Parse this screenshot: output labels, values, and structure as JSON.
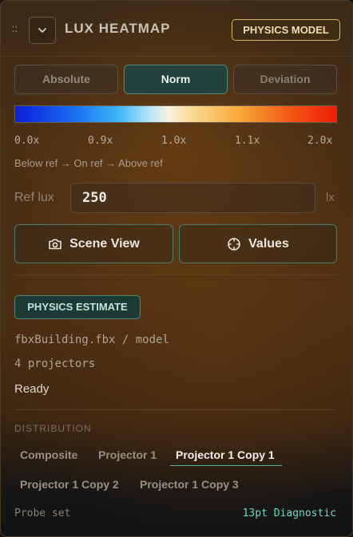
{
  "header": {
    "grip_glyph": "::",
    "title": "LUX HEATMAP",
    "badge": "PHYSICS MODEL",
    "collapse_icon": "chevron-down-icon"
  },
  "modes": [
    {
      "label": "Absolute",
      "active": false
    },
    {
      "label": "Norm",
      "active": true
    },
    {
      "label": "Deviation",
      "active": false
    }
  ],
  "scale": {
    "ticks": [
      "0.0x",
      "0.9x",
      "1.0x",
      "1.1x",
      "2.0x"
    ],
    "note": "Below ref → On ref → Above ref",
    "colors": [
      "#0a1ed8",
      "#3cb6f6",
      "#f7f2dc",
      "#f8a838",
      "#ee1c08"
    ]
  },
  "ref": {
    "label": "Ref lux",
    "value": "250",
    "unit": "lx"
  },
  "actions": {
    "scene_view": "Scene View",
    "values": "Values",
    "scene_icon": "camera-icon",
    "values_icon": "crosshair-icon"
  },
  "estimate": {
    "badge": "PHYSICS ESTIMATE",
    "model": "fbxBuilding.fbx / model",
    "projectors": "4 projectors",
    "status": "Ready"
  },
  "distribution": {
    "label": "DISTRIBUTION",
    "tabs": [
      {
        "label": "Composite",
        "active": false
      },
      {
        "label": "Projector 1",
        "active": false
      },
      {
        "label": "Projector 1 Copy 1",
        "active": true
      },
      {
        "label": "Projector 1 Copy 2",
        "active": false
      },
      {
        "label": "Projector 1 Copy 3",
        "active": false
      }
    ]
  },
  "footer": {
    "probe_label": "Probe set",
    "probe_value": "13pt Diagnostic"
  },
  "colors": {
    "accent_teal": "#4f8a80",
    "badge_gold": "#d6b26a",
    "probe_teal": "#6fd7c4"
  }
}
